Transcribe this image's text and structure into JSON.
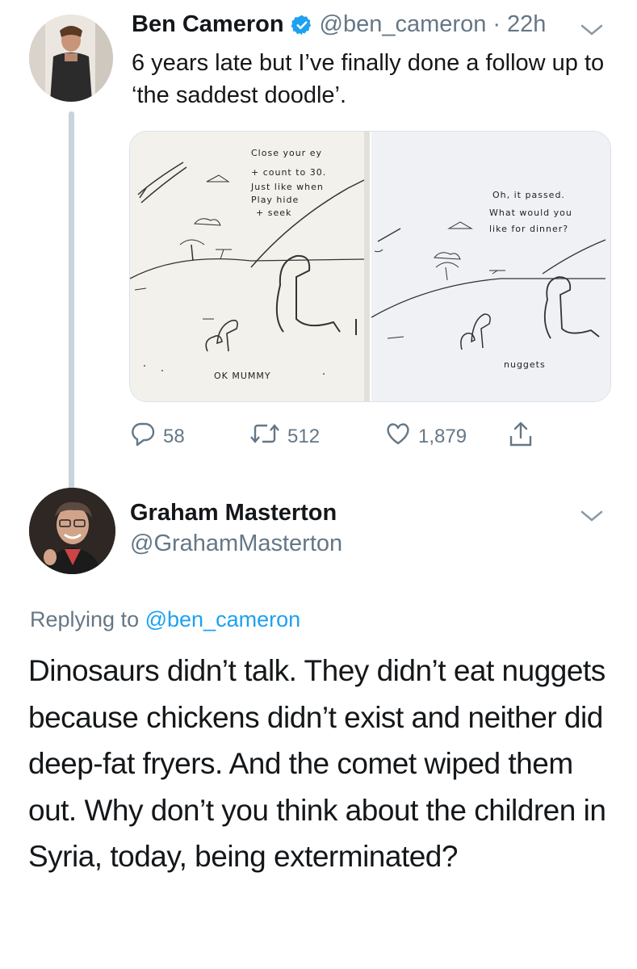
{
  "tweet1": {
    "author_name": "Ben Cameron",
    "author_handle": "@ben_cameron",
    "separator": "·",
    "time": "22h",
    "text": "6 years late but I’ve finally done a follow up to ‘the saddest doodle’.",
    "icons": {
      "verified": "verified-badge-icon",
      "menu": "chevron-down-icon"
    },
    "media": {
      "left_panel": {
        "lines": [
          "Close    your   ey",
          "+  count  to   30.",
          "Just  like  when",
          "Play  hide",
          "+ seek"
        ],
        "caption": "OK    MUMMY"
      },
      "right_panel": {
        "lines": [
          "Oh,   it  passed.",
          "What  would  you",
          "like  for  dinner?"
        ],
        "caption": "nuggets"
      }
    },
    "actions": {
      "replies": "58",
      "retweets": "512",
      "likes": "1,879"
    }
  },
  "tweet2": {
    "author_name": "Graham Masterton",
    "author_handle": "@GrahamMasterton",
    "replying_prefix": "Replying to ",
    "replying_handle": "@ben_cameron",
    "text": "Dinosaurs didn’t talk. They didn’t eat nuggets because chickens didn’t exist and neither did deep-fat fryers. And the comet wiped them out. Why don’t you think about the children in Syria, today, being exterminated?"
  },
  "colors": {
    "text_primary": "#14171a",
    "text_secondary": "#657786",
    "link": "#1da1f2",
    "thread_line": "#c9d3db"
  }
}
